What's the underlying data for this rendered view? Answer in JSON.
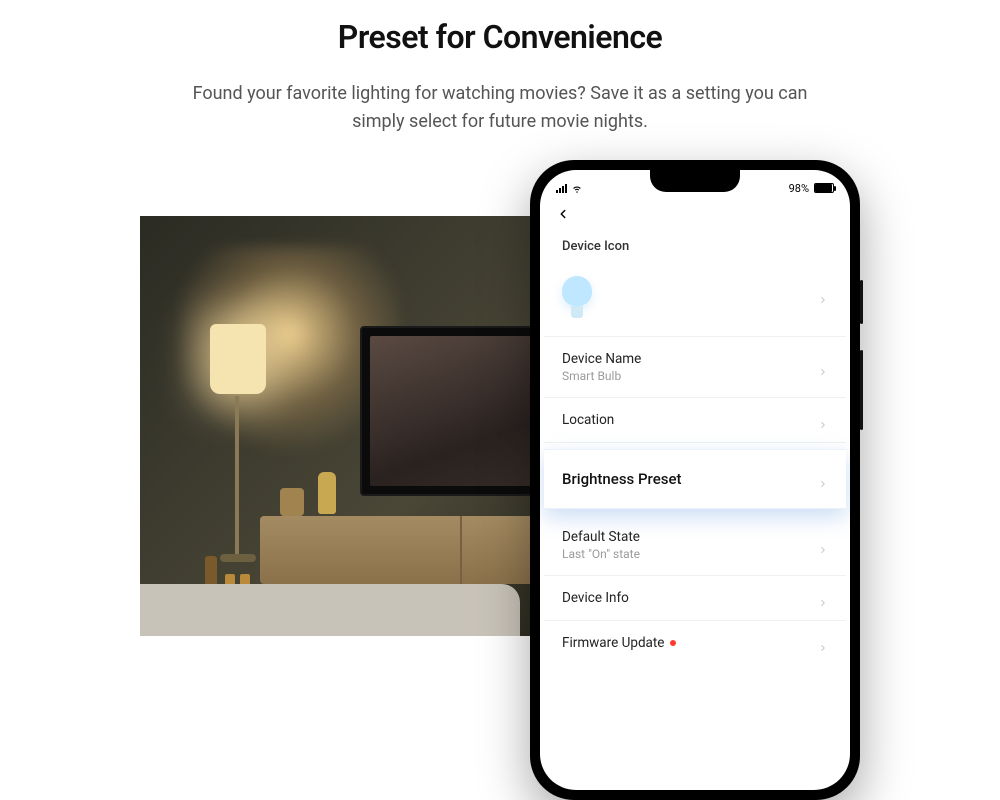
{
  "header": {
    "title": "Preset for Convenience",
    "subtitle": "Found your favorite lighting for watching movies? Save it as a setting you can simply select for future movie nights."
  },
  "status": {
    "battery_pct": "98%"
  },
  "settings": {
    "device_icon_label": "Device Icon",
    "device_name_label": "Device Name",
    "device_name_value": "Smart Bulb",
    "location_label": "Location",
    "brightness_preset_label": "Brightness Preset",
    "default_state_label": "Default State",
    "default_state_value": "Last \"On\" state",
    "device_info_label": "Device Info",
    "firmware_update_label": "Firmware Update"
  }
}
